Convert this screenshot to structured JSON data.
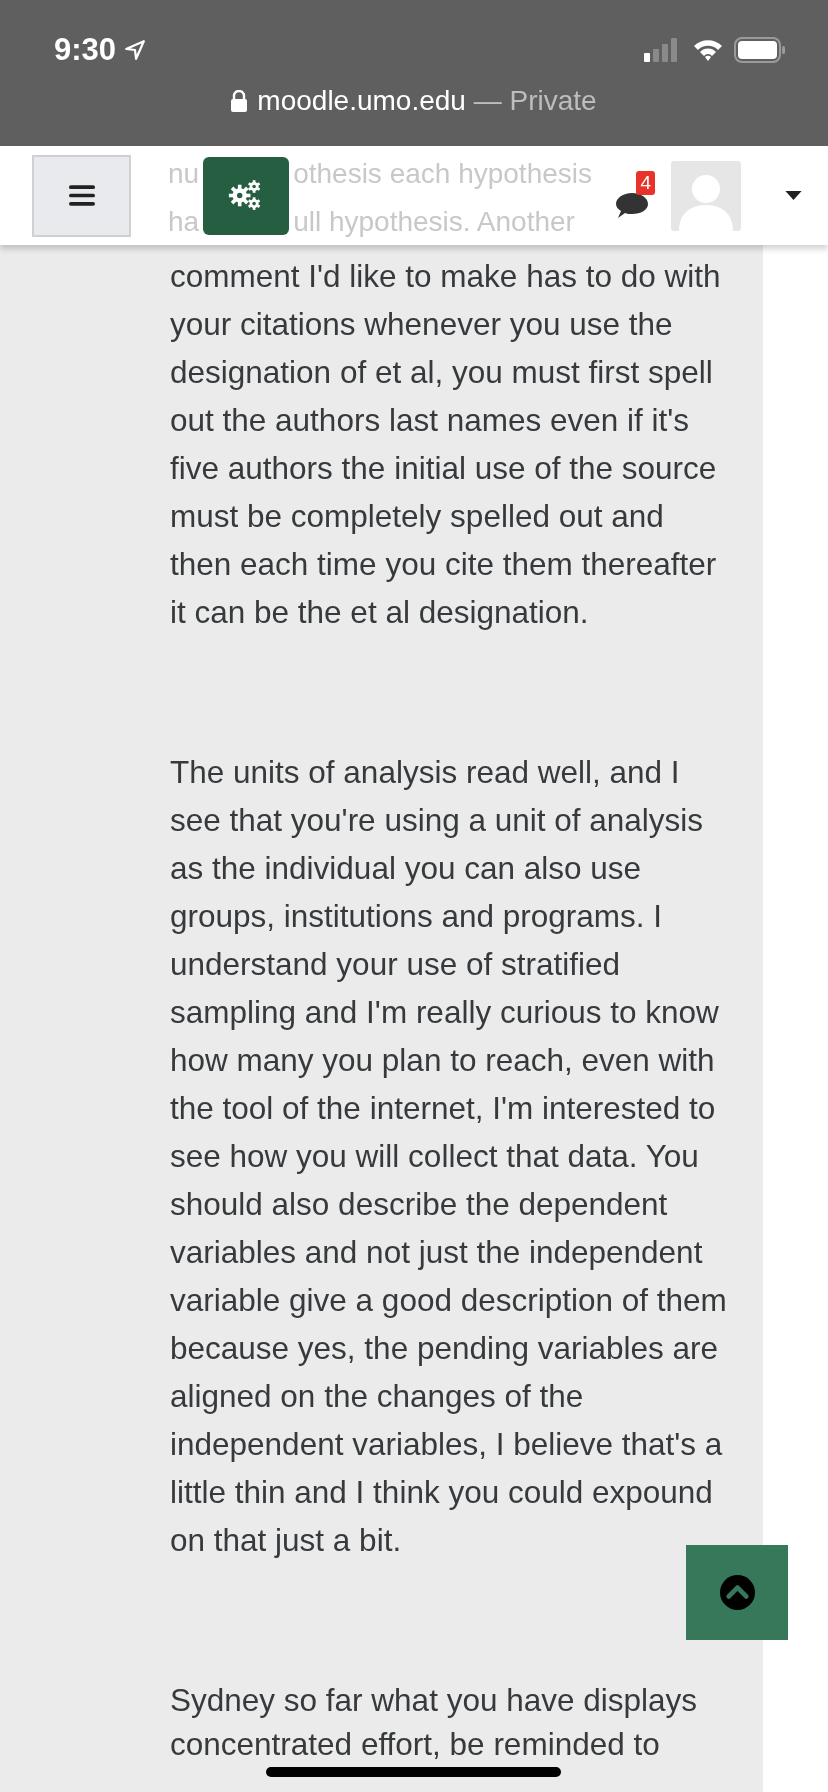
{
  "status_bar": {
    "time": "9:30"
  },
  "address_bar": {
    "domain": "moodle.umo.edu",
    "mode": " — Private"
  },
  "header": {
    "notification_count": "4",
    "faded_lines": [
      {
        "parts": [
          "nu",
          "othesis each hypothesis"
        ]
      },
      {
        "parts": [
          "ha",
          "ull hypothesis.  Another"
        ]
      }
    ]
  },
  "paragraphs": [
    {
      "lines": [
        "comment I'd like to make has to do with",
        "your citations whenever you use the",
        "designation of et al, you must first spell",
        "out the authors last names even if it's",
        "five authors the initial use of the source",
        "must be completely spelled out and",
        "then each time you cite them thereafter",
        "it can be the et al designation."
      ]
    },
    {
      "lines": [
        "The units of analysis read well, and I",
        "see that you're using a unit of analysis",
        "as the individual you can also use",
        "groups, institutions and programs.   I",
        "understand your use of stratified",
        "sampling and I'm really curious to know",
        "how many you plan to reach, even with",
        "the tool of the internet, I'm interested to",
        "see how you will collect that data. You",
        "should also describe the dependent",
        "variables and not just the independent",
        "variable give a good description of them",
        "because yes, the pending variables are",
        "aligned on the changes of the",
        "independent variables, I believe that's a",
        "little thin and I think you could expound",
        "on that just a bit."
      ]
    },
    {
      "lines": [
        "Sydney so far what you have displays",
        "concentrated effort, be reminded to"
      ]
    }
  ]
}
